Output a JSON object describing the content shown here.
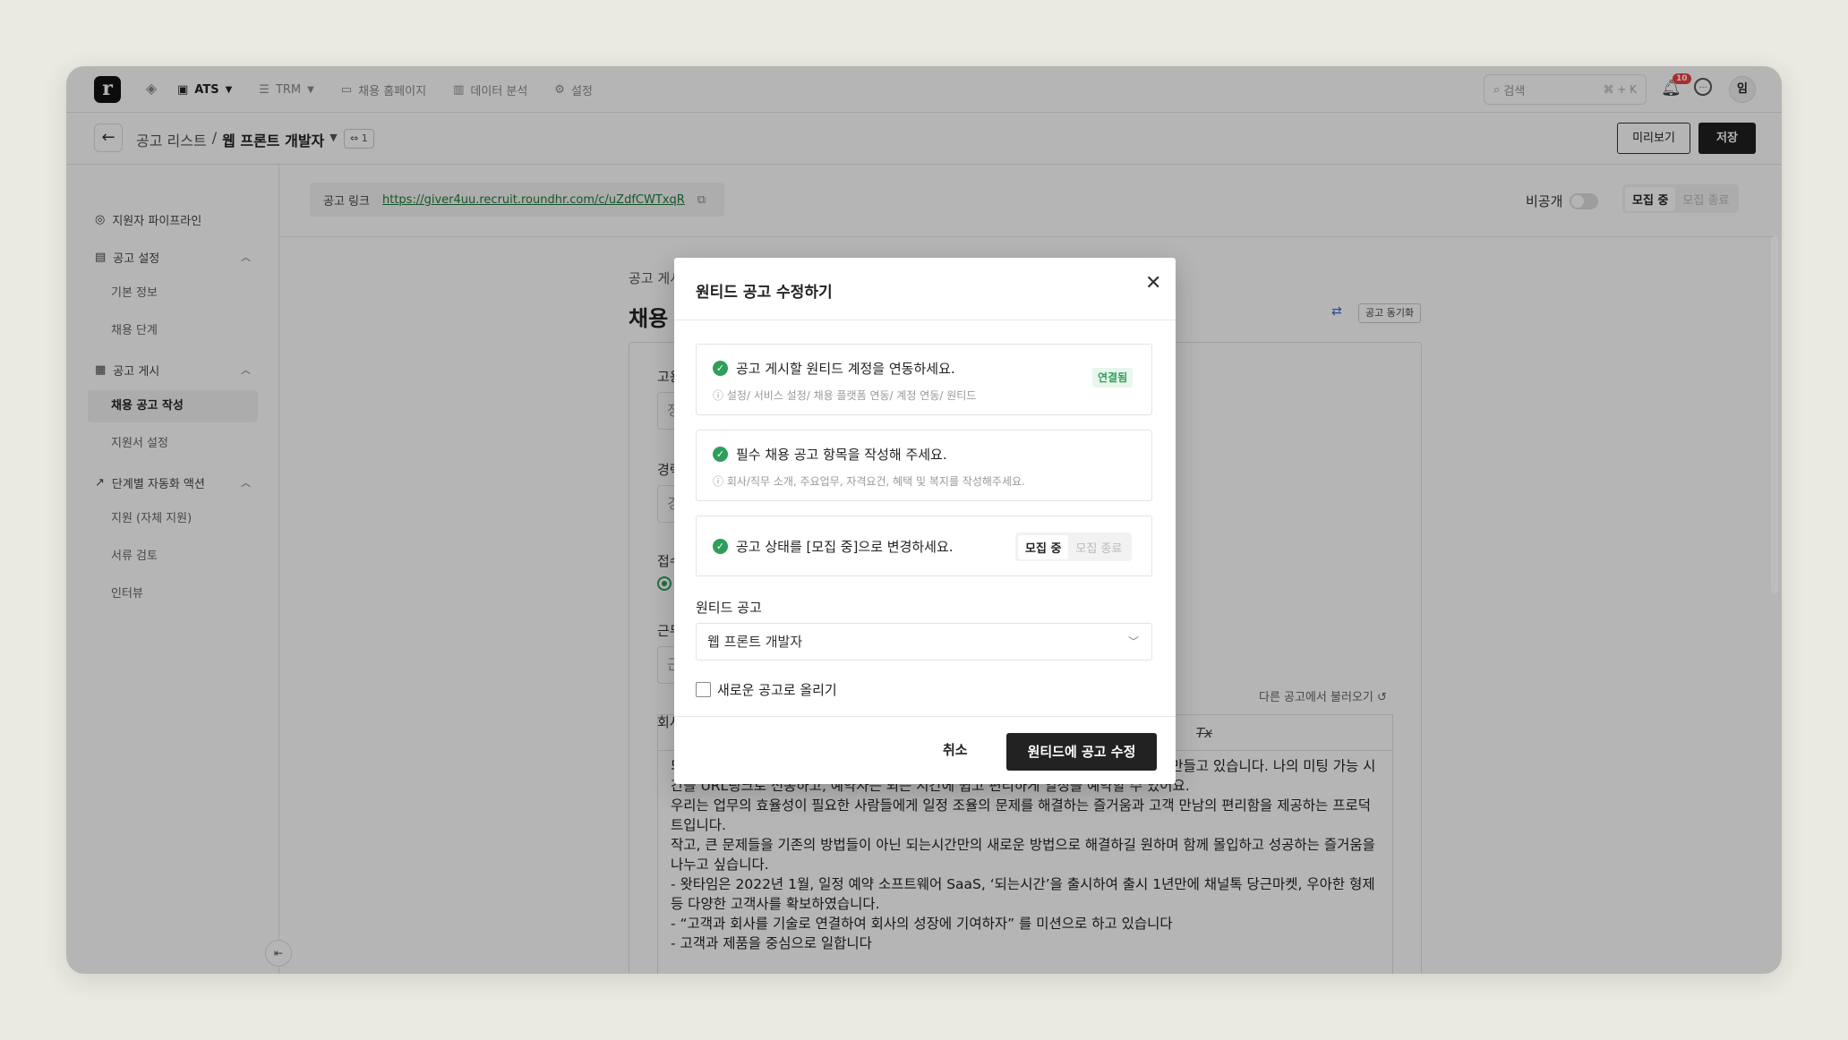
{
  "nav": {
    "logo": "r",
    "items": [
      {
        "label": "ATS",
        "icon": "briefcase-icon",
        "active": true
      },
      {
        "label": "TRM",
        "icon": "database-icon",
        "active": false
      },
      {
        "label": "채용 홈페이지",
        "icon": "window-icon",
        "active": false
      },
      {
        "label": "데이터 분석",
        "icon": "bar-chart-icon",
        "active": false
      },
      {
        "label": "설정",
        "icon": "gear-icon",
        "active": false
      }
    ],
    "search_placeholder": "검색",
    "search_shortcut": "⌘ + K",
    "notification_count": "10",
    "avatar": "임"
  },
  "subbar": {
    "breadcrumb_parent": "공고 리스트",
    "breadcrumb_sep": "/",
    "breadcrumb_current": "웹 프론트 개발자",
    "link_count": "⇔ 1",
    "preview_label": "미리보기",
    "save_label": "저장"
  },
  "sidebar": {
    "items": [
      {
        "label": "지원자 파이프라인",
        "icon": "target-icon"
      },
      {
        "label": "공고 설정",
        "icon": "clipboard-icon"
      },
      {
        "label": "기본 정보"
      },
      {
        "label": "채용 단계"
      },
      {
        "label": "공고 게시",
        "icon": "calendar-icon"
      },
      {
        "label": "채용 공고 작성",
        "active": true
      },
      {
        "label": "지원서 설정"
      },
      {
        "label": "단계별 자동화 액션",
        "icon": "trend-icon"
      },
      {
        "label": "지원 (자체 지원)"
      },
      {
        "label": "서류 검토"
      },
      {
        "label": "인터뷰"
      }
    ]
  },
  "main": {
    "link_label": "공고 링크",
    "link_url": "https://giver4uu.recruit.roundhr.com/c/uZdfCWTxqR",
    "private_label": "비공개",
    "status_on": "모집 중",
    "status_off": "모집 종료",
    "section_label": "공고 게시",
    "section_title": "채용 공고",
    "sync_label": "공고 동기화",
    "field_labels": [
      "고용",
      "경력",
      "접수",
      "근무",
      "회사"
    ],
    "field_values": [
      "정",
      "경",
      "",
      "근"
    ],
    "import_label": "다른 공고에서 불러오기",
    "editor_text": [
      "되는시간은 캘린더 연동 기반 비즈니스 일정 조율 서비스로 업무 방식의 새로운 문화를 만들고 있습니다. 나의 미팅 가능 시간을 URL링크로 전송하고, 예약자는 되는 시간에 쉽고 편리하게 일정을 예약할 수 있어요.",
      "우리는 업무의 효율성이 필요한 사람들에게 일정 조율의 문제를 해결하는 즐거움과 고객 만남의 편리함을 제공하는 프로덕트입니다.",
      "작고, 큰 문제들을 기존의 방법들이 아닌 되는시간만의 새로운 방법으로 해결하길 원하며 함께 몰입하고 성공하는 즐거움을 나누고 싶습니다.",
      "- 왓타임은 2022년 1월, 일정 예약 소프트웨어 SaaS, ‘되는시간’을 출시하여 출시 1년만에 채널톡 당근마켓, 우아한 형제등 다양한 고객사를 확보하였습니다.",
      "- “고객과 회사를 기술로 연결하여 회사의 성장에 기여하자” 를 미션으로 하고 있습니다",
      "- 고객과 제품을 중심으로 일합니다"
    ]
  },
  "modal": {
    "title": "원티드 공고 수정하기",
    "steps": [
      {
        "title": "공고 게시할 원티드 계정을 연동하세요.",
        "hint": "ⓘ 설정/ 서비스 설정/ 채용 플랫폼 연동/ 계정 연동/ 원티드",
        "badge": "연결됨"
      },
      {
        "title": "필수 채용 공고 항목을 작성해 주세요.",
        "hint": "ⓘ 회사/직무 소개, 주요업무, 자격요건, 혜택 및 복지를 작성해주세요."
      },
      {
        "title": "공고 상태를 [모집 중]으로 변경하세요.",
        "seg_on": "모집 중",
        "seg_off": "모집 종료"
      }
    ],
    "wanted_label": "원티드 공고",
    "wanted_selected": "웹 프론트 개발자",
    "new_post_label": "새로운 공고로 올리기",
    "cancel_label": "취소",
    "submit_label": "원티드에 공고 수정"
  },
  "colors": {
    "accent_green": "#2e9e5a",
    "dark_button": "#222222",
    "badge_red": "#ef4040"
  }
}
